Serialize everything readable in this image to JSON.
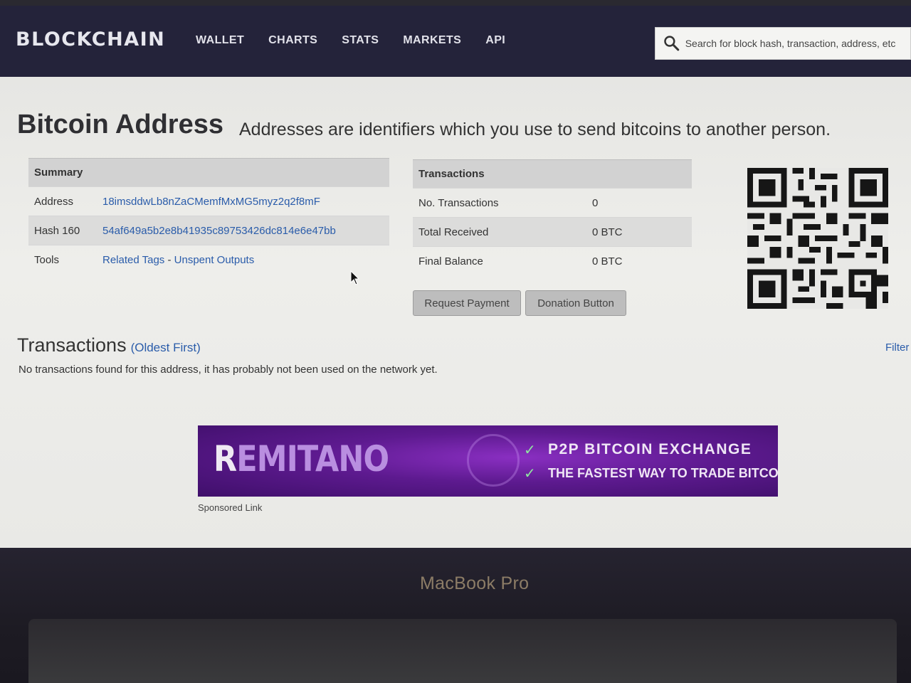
{
  "nav": {
    "brand": "BLOCKCHAIN",
    "links": [
      "WALLET",
      "CHARTS",
      "STATS",
      "MARKETS",
      "API"
    ],
    "search_placeholder": "Search for block hash, transaction, address, etc"
  },
  "page": {
    "title": "Bitcoin Address",
    "subtitle": "Addresses are identifiers which you use to send bitcoins to another person."
  },
  "summary": {
    "header": "Summary",
    "rows": [
      {
        "label": "Address",
        "value": "18imsddwLb8nZaCMemfMxMG5myz2q2f8mF"
      },
      {
        "label": "Hash 160",
        "value": "54af649a5b2e8b41935c89753426dc814e6e47bb"
      },
      {
        "label": "Tools",
        "link1": "Related Tags",
        "sep": " - ",
        "link2": "Unspent Outputs"
      }
    ]
  },
  "transactions_table": {
    "header": "Transactions",
    "rows": [
      {
        "label": "No. Transactions",
        "value": "0"
      },
      {
        "label": "Total Received",
        "value": "0 BTC"
      },
      {
        "label": "Final Balance",
        "value": "0 BTC"
      }
    ]
  },
  "buttons": {
    "request_payment": "Request Payment",
    "donation_button": "Donation Button"
  },
  "tx_section": {
    "heading": "Transactions",
    "order": "(Oldest First)",
    "filter": "Filter",
    "empty_message": "No transactions found for this address, it has probably not been used on the network yet."
  },
  "banner": {
    "logo_first": "R",
    "logo_rest": "EMITANO",
    "line1": "P2P BITCOIN EXCHANGE",
    "line2": "THE FASTEST WAY TO TRADE BITCOIN",
    "sponsored": "Sponsored Link"
  },
  "device": {
    "label": "MacBook Pro"
  },
  "colors": {
    "nav_bg": "#24233a",
    "link": "#2a5caa",
    "banner_purple": "#5d1a8f"
  }
}
